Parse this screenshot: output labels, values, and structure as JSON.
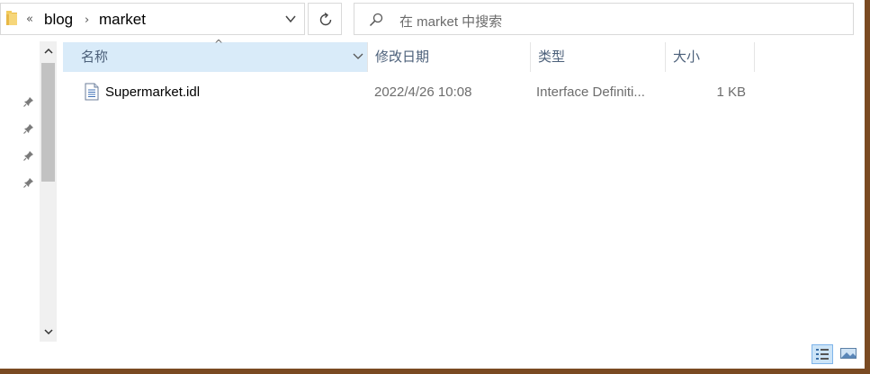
{
  "address_bar": {
    "overflow": "«",
    "crumbs": [
      "blog",
      "market"
    ],
    "separator": "›"
  },
  "search": {
    "placeholder": "在 market 中搜索"
  },
  "columns": {
    "name": "名称",
    "date": "修改日期",
    "type": "类型",
    "size": "大小",
    "sort_indicator": "^"
  },
  "files": [
    {
      "name": "Supermarket.idl",
      "modified": "2022/4/26 10:08",
      "type": "Interface Definiti...",
      "size": "1 KB"
    }
  ],
  "icons": {
    "folder": "folder-icon",
    "refresh": "refresh-icon",
    "search": "search-icon",
    "pin": "pin-icon",
    "file": "document-icon",
    "details_view": "details-view-icon",
    "tiles_view": "large-icons-view-icon"
  },
  "colors": {
    "selected_header": "#d9ebf9",
    "header_text": "#4c607a",
    "secondary_text": "#6d6d6d"
  }
}
